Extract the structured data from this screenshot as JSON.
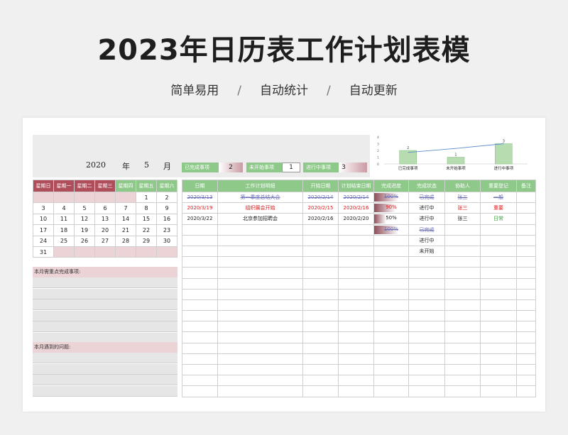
{
  "hero": {
    "title": "2023年日历表工作计划表模",
    "sub1": "简单易用",
    "sub2": "自动统计",
    "sub3": "自动更新",
    "sep": "/"
  },
  "header": {
    "year": "2020",
    "year_unit": "年",
    "month": "5",
    "month_unit": "月"
  },
  "stats": [
    {
      "label": "已完成事项",
      "value": "2"
    },
    {
      "label": "未开始事项",
      "value": "1"
    },
    {
      "label": "进行中事项",
      "value": "3"
    }
  ],
  "chart_data": {
    "type": "bar",
    "categories": [
      "已完成事项",
      "未开始事项",
      "进行中事项"
    ],
    "values": [
      2,
      1,
      3
    ],
    "ylim": [
      0,
      4
    ],
    "yticks": [
      "0",
      "1",
      "2",
      "3",
      "4"
    ],
    "overlay": "line",
    "bar_color": "#b6dcb0",
    "line_color": "#5b8ec9"
  },
  "calendar": {
    "weekdays": [
      "星期日",
      "星期一",
      "星期二",
      "星期三",
      "星期四",
      "星期五",
      "星期六"
    ],
    "weeks": [
      [
        "",
        "",
        "",
        "",
        "",
        "1",
        "2"
      ],
      [
        "3",
        "4",
        "5",
        "6",
        "7",
        "8",
        "9"
      ],
      [
        "10",
        "11",
        "12",
        "13",
        "14",
        "15",
        "16"
      ],
      [
        "17",
        "18",
        "19",
        "20",
        "21",
        "22",
        "23"
      ],
      [
        "24",
        "25",
        "26",
        "27",
        "28",
        "29",
        "30"
      ],
      [
        "31",
        "",
        "",
        "",
        "",
        "",
        ""
      ]
    ]
  },
  "sections": {
    "key_items": "本月需重点完成事项:",
    "problems": "本月遇到的问题:"
  },
  "tasks": {
    "columns": [
      "日期",
      "工作计划明细",
      "开始日期",
      "计划结束日期",
      "完成进度",
      "完成状态",
      "协助人",
      "重要登记",
      "备注"
    ],
    "rows": [
      {
        "date": "2020/3/13",
        "detail": "第一季度总结大会",
        "start": "2020/2/14",
        "end": "2020/2/14",
        "progress": "100%",
        "progress_value": 1.0,
        "status": "已完成",
        "helper": "张三",
        "priority": "一般",
        "note": "",
        "style": "strike"
      },
      {
        "date": "2020/3/19",
        "detail": "组织展会开始",
        "start": "2020/2/15",
        "end": "2020/2/16",
        "progress": "90%",
        "progress_value": 0.9,
        "status": "进行中",
        "helper": "张三",
        "priority": "重要",
        "note": "",
        "style": "red"
      },
      {
        "date": "2020/3/22",
        "detail": "北京参加招聘会",
        "start": "2020/2/16",
        "end": "2020/2/20",
        "progress": "50%",
        "progress_value": 0.5,
        "status": "进行中",
        "helper": "张三",
        "priority": "日常",
        "note": "",
        "style": "normal"
      },
      {
        "date": "",
        "detail": "",
        "start": "",
        "end": "",
        "progress": "100%",
        "progress_value": 1.0,
        "status": "已完成",
        "helper": "",
        "priority": "",
        "note": "",
        "style": "strike-partial"
      },
      {
        "date": "",
        "detail": "",
        "start": "",
        "end": "",
        "progress": "",
        "progress_value": 0,
        "status": "进行中",
        "helper": "",
        "priority": "",
        "note": "",
        "style": "normal"
      },
      {
        "date": "",
        "detail": "",
        "start": "",
        "end": "",
        "progress": "",
        "progress_value": 0,
        "status": "未开始",
        "helper": "",
        "priority": "",
        "note": "",
        "style": "normal"
      }
    ],
    "empty_rows": 13
  }
}
